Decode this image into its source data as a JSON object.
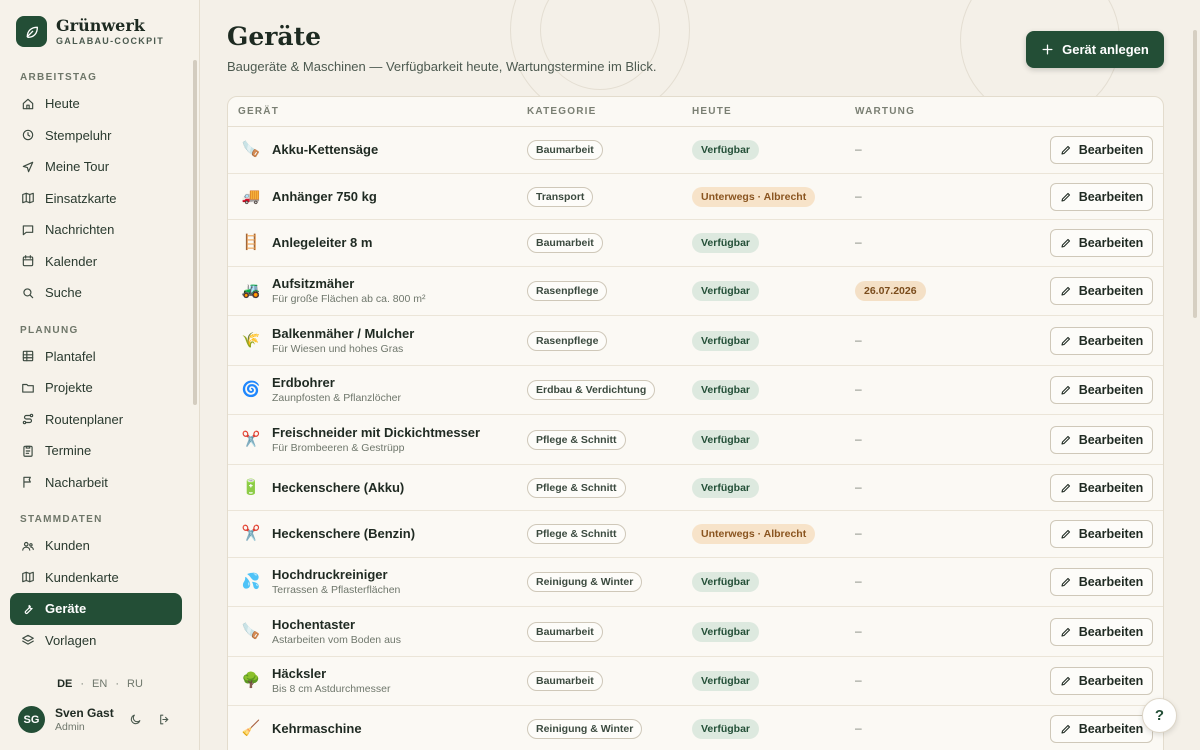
{
  "brand": {
    "name": "Grünwerk",
    "subtitle": "GALABAU-COCKPIT",
    "logo_icon": "leaf-icon"
  },
  "sidebar": {
    "sections": [
      {
        "label": "ARBEITSTAG",
        "items": [
          {
            "label": "Heute",
            "icon": "home-icon"
          },
          {
            "label": "Stempeluhr",
            "icon": "clock-icon"
          },
          {
            "label": "Meine Tour",
            "icon": "navigation-icon"
          },
          {
            "label": "Einsatzkarte",
            "icon": "map-icon"
          },
          {
            "label": "Nachrichten",
            "icon": "message-icon"
          },
          {
            "label": "Kalender",
            "icon": "calendar-icon"
          },
          {
            "label": "Suche",
            "icon": "search-icon"
          }
        ]
      },
      {
        "label": "PLANUNG",
        "items": [
          {
            "label": "Plantafel",
            "icon": "grid-icon"
          },
          {
            "label": "Projekte",
            "icon": "folder-icon"
          },
          {
            "label": "Routenplaner",
            "icon": "route-icon"
          },
          {
            "label": "Termine",
            "icon": "clipboard-icon"
          },
          {
            "label": "Nacharbeit",
            "icon": "flag-icon"
          }
        ]
      },
      {
        "label": "STAMMDATEN",
        "items": [
          {
            "label": "Kunden",
            "icon": "users-icon"
          },
          {
            "label": "Kundenkarte",
            "icon": "map-icon"
          },
          {
            "label": "Geräte",
            "icon": "wrench-icon",
            "active": true
          },
          {
            "label": "Vorlagen",
            "icon": "layers-icon"
          }
        ]
      }
    ],
    "languages": [
      "DE",
      "EN",
      "RU"
    ],
    "active_language": "DE",
    "user": {
      "initials": "SG",
      "name": "Sven Gast",
      "role": "Admin"
    }
  },
  "page": {
    "title": "Geräte",
    "subtitle": "Baugeräte & Maschinen — Verfügbarkeit heute, Wartungstermine im Blick.",
    "add_button": "Gerät anlegen"
  },
  "table": {
    "columns": [
      "GERÄT",
      "KATEGORIE",
      "HEUTE",
      "WARTUNG"
    ],
    "edit_label": "Bearbeiten",
    "rows": [
      {
        "icon": "🪚",
        "name": "Akku-Kettensäge",
        "desc": "",
        "category": "Baumarbeit",
        "status": "Verfügbar",
        "status_type": "ok",
        "wartung": "–"
      },
      {
        "icon": "🚚",
        "name": "Anhänger 750 kg",
        "desc": "",
        "category": "Transport",
        "status": "Unterwegs · Albrecht",
        "status_type": "away",
        "wartung": "–"
      },
      {
        "icon": "🪜",
        "name": "Anlegeleiter 8 m",
        "desc": "",
        "category": "Baumarbeit",
        "status": "Verfügbar",
        "status_type": "ok",
        "wartung": "–"
      },
      {
        "icon": "🚜",
        "name": "Aufsitzmäher",
        "desc": "Für große Flächen ab ca. 800 m²",
        "category": "Rasenpflege",
        "status": "Verfügbar",
        "status_type": "ok",
        "wartung": "26.07.2026",
        "wartung_type": "date"
      },
      {
        "icon": "🌾",
        "name": "Balkenmäher / Mulcher",
        "desc": "Für Wiesen und hohes Gras",
        "category": "Rasenpflege",
        "status": "Verfügbar",
        "status_type": "ok",
        "wartung": "–"
      },
      {
        "icon": "🌀",
        "name": "Erdbohrer",
        "desc": "Zaunpfosten & Pflanzlöcher",
        "category": "Erdbau & Verdichtung",
        "status": "Verfügbar",
        "status_type": "ok",
        "wartung": "–"
      },
      {
        "icon": "✂️",
        "name": "Freischneider mit Dickichtmesser",
        "desc": "Für Brombeeren & Gestrüpp",
        "category": "Pflege & Schnitt",
        "status": "Verfügbar",
        "status_type": "ok",
        "wartung": "–"
      },
      {
        "icon": "🔋",
        "name": "Heckenschere (Akku)",
        "desc": "",
        "category": "Pflege & Schnitt",
        "status": "Verfügbar",
        "status_type": "ok",
        "wartung": "–"
      },
      {
        "icon": "✂️",
        "name": "Heckenschere (Benzin)",
        "desc": "",
        "category": "Pflege & Schnitt",
        "status": "Unterwegs · Albrecht",
        "status_type": "away",
        "wartung": "–"
      },
      {
        "icon": "💦",
        "name": "Hochdruckreiniger",
        "desc": "Terrassen & Pflasterflächen",
        "category": "Reinigung & Winter",
        "status": "Verfügbar",
        "status_type": "ok",
        "wartung": "–"
      },
      {
        "icon": "🪚",
        "name": "Hochentaster",
        "desc": "Astarbeiten vom Boden aus",
        "category": "Baumarbeit",
        "status": "Verfügbar",
        "status_type": "ok",
        "wartung": "–"
      },
      {
        "icon": "🌳",
        "name": "Häcksler",
        "desc": "Bis 8 cm Astdurchmesser",
        "category": "Baumarbeit",
        "status": "Verfügbar",
        "status_type": "ok",
        "wartung": "–"
      },
      {
        "icon": "🧹",
        "name": "Kehrmaschine",
        "desc": "",
        "category": "Reinigung & Winter",
        "status": "Verfügbar",
        "status_type": "ok",
        "wartung": "–"
      }
    ]
  },
  "help_label": "?"
}
